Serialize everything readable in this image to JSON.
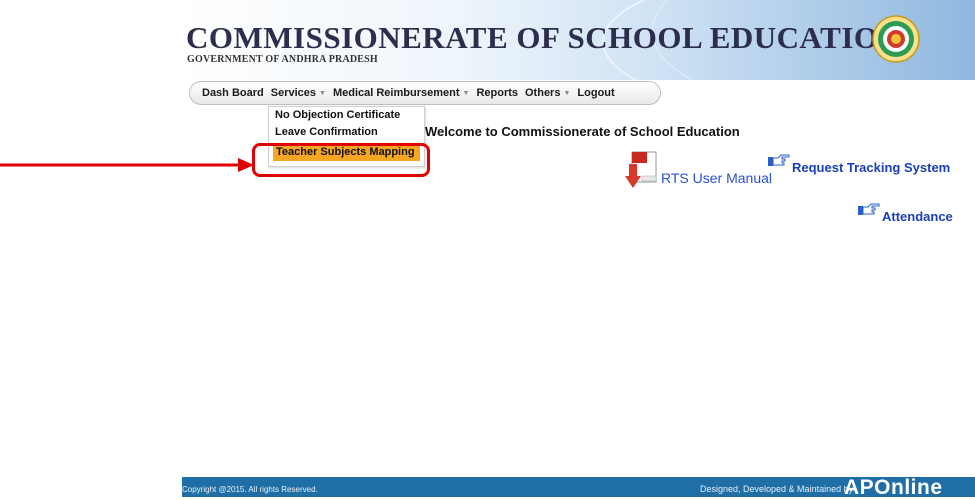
{
  "header": {
    "title": "COMMISSIONERATE OF SCHOOL EDUCATION",
    "subtitle": "GOVERNMENT OF ANDHRA PRADESH"
  },
  "nav": {
    "items": [
      {
        "label": "Dash Board",
        "has_caret": false
      },
      {
        "label": "Services",
        "has_caret": true
      },
      {
        "label": "Medical Reimbursement",
        "has_caret": true
      },
      {
        "label": "Reports",
        "has_caret": false
      },
      {
        "label": "Others",
        "has_caret": true
      },
      {
        "label": "Logout",
        "has_caret": false
      }
    ],
    "caret_glyph": "▼"
  },
  "services_menu": {
    "items": [
      {
        "label": "No Objection Certificate"
      },
      {
        "label": "Leave Confirmation"
      },
      {
        "label": "Teacher Subjects Mapping",
        "active": true
      }
    ]
  },
  "main": {
    "welcome": "Welcome to Commissionerate of School Education",
    "rts_manual": "RTS User Manual",
    "request_tracking": "Request Tracking System",
    "attendance": "Attendance"
  },
  "footer": {
    "copyright": "Copyright @2015. All rights Reserved.",
    "designed_by": "Designed, Developed & Maintained by",
    "brand": "APOnline"
  },
  "colors": {
    "highlight_red": "#e00000",
    "active_item": "#f5a623",
    "link_blue": "#1b3fb8",
    "footer_blue": "#1f6fa6"
  },
  "icons": {
    "emblem": "state-emblem-icon",
    "pdf": "pdf-download-icon",
    "pointer": "pointing-hand-icon"
  }
}
